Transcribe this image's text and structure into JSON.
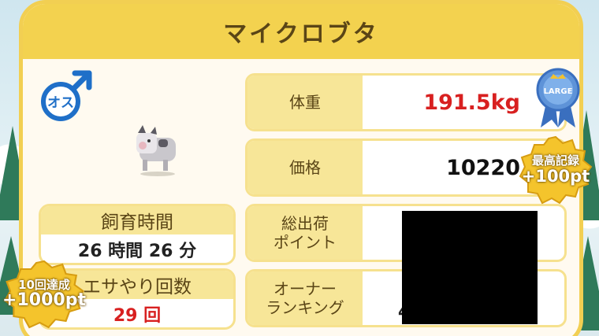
{
  "title": "マイクロブタ",
  "gender": {
    "label": "オス",
    "icon": "male-symbol-icon",
    "color": "#1f6fc8"
  },
  "pig_icon": "micro-pig-icon",
  "raising_time": {
    "label": "飼育時間",
    "value": "26 時間 26 分"
  },
  "feeding_count": {
    "label": "エサやり回数",
    "value": "29 回"
  },
  "stats": [
    {
      "label": "体重",
      "value": "191.5kg",
      "value_color": "#d82020"
    },
    {
      "label": "価格",
      "value": "10220",
      "value_color": "#111111"
    },
    {
      "label": "総出荷\nポイント",
      "value": ""
    },
    {
      "label": "オーナー\nランキング",
      "value": "4"
    }
  ],
  "badges": {
    "size_badge": "LARGE",
    "record_badge": {
      "line1": "最高記録",
      "line2": "+100pt"
    },
    "achievement_badge": {
      "line1": "10回達成",
      "line2": "+1000pt"
    }
  },
  "colors": {
    "header": "#f3d24f",
    "label_bg": "#f7e698",
    "border": "#f6e18e",
    "accent_red": "#d82020"
  }
}
